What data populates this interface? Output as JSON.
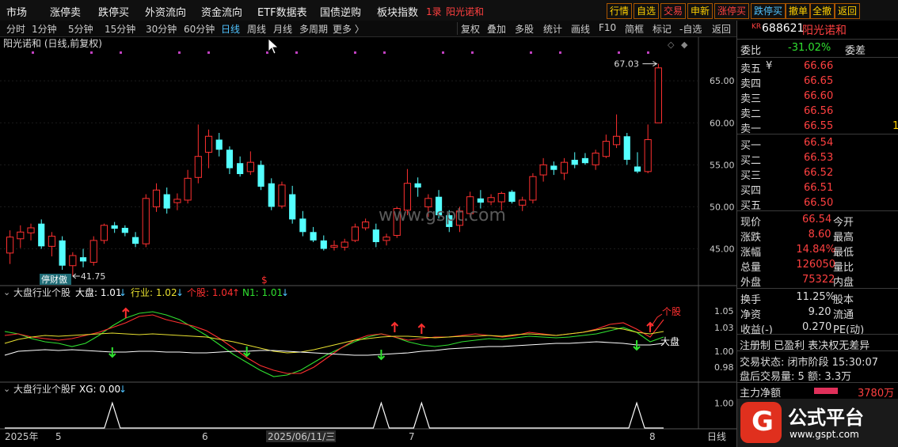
{
  "menu": {
    "left": [
      "市场",
      "涨停卖",
      "跌停买",
      "外资流向",
      "资金流向",
      "ETF数据表",
      "国债逆购",
      "板块指数"
    ],
    "tag": "1录",
    "stock_tag": "阳光诺和",
    "right": [
      "行情",
      "自选",
      "交易",
      "申新",
      "涨停买",
      "跌停买",
      "撤单",
      "全撤",
      "返回"
    ]
  },
  "periods": [
    "分时",
    "1分钟",
    "5分钟",
    "15分钟",
    "30分钟",
    "60分钟",
    "日线",
    "周线",
    "月线",
    "多周期",
    "更多 〉"
  ],
  "active_period": "日线",
  "tools": [
    "复权",
    "叠加",
    "多股",
    "统计",
    "画线",
    "F10",
    "简框",
    "标记",
    "-自选",
    "返回"
  ],
  "chart_title": "阳光诺和 (日线,前复权)",
  "chart_data": [
    {
      "type": "candlestick",
      "title": "阳光诺和 (日线,前复权)",
      "y_ticks": [
        45.0,
        50.0,
        55.0,
        60.0,
        65.0
      ],
      "ylim": [
        41.0,
        68.5
      ],
      "max_label": "67.03",
      "min_label": "41.75",
      "candles": [
        {
          "o": 44.5,
          "h": 47.2,
          "l": 43.2,
          "c": 46.4
        },
        {
          "o": 46.2,
          "h": 47.8,
          "l": 45.1,
          "c": 47.0
        },
        {
          "o": 46.9,
          "h": 48.0,
          "l": 46.0,
          "c": 47.5
        },
        {
          "o": 48.0,
          "h": 48.5,
          "l": 45.0,
          "c": 45.3
        },
        {
          "o": 45.3,
          "h": 47.0,
          "l": 44.1,
          "c": 46.5
        },
        {
          "o": 46.0,
          "h": 46.5,
          "l": 42.5,
          "c": 43.0
        },
        {
          "o": 43.0,
          "h": 44.6,
          "l": 41.75,
          "c": 44.2
        },
        {
          "o": 44.0,
          "h": 45.0,
          "l": 42.8,
          "c": 43.5
        },
        {
          "o": 43.4,
          "h": 46.5,
          "l": 43.0,
          "c": 46.0
        },
        {
          "o": 46.0,
          "h": 48.0,
          "l": 45.6,
          "c": 47.8
        },
        {
          "o": 47.8,
          "h": 48.2,
          "l": 46.9,
          "c": 47.4
        },
        {
          "o": 47.5,
          "h": 47.8,
          "l": 46.5,
          "c": 46.9
        },
        {
          "o": 46.4,
          "h": 47.0,
          "l": 45.2,
          "c": 45.6
        },
        {
          "o": 45.6,
          "h": 51.5,
          "l": 45.2,
          "c": 51.0
        },
        {
          "o": 50.0,
          "h": 52.8,
          "l": 49.4,
          "c": 52.0
        },
        {
          "o": 51.5,
          "h": 52.3,
          "l": 49.2,
          "c": 49.8
        },
        {
          "o": 50.5,
          "h": 51.6,
          "l": 49.6,
          "c": 50.9
        },
        {
          "o": 50.8,
          "h": 54.4,
          "l": 50.4,
          "c": 53.4
        },
        {
          "o": 53.5,
          "h": 59.8,
          "l": 52.8,
          "c": 56.0
        },
        {
          "o": 56.5,
          "h": 59.2,
          "l": 54.6,
          "c": 58.4
        },
        {
          "o": 58.0,
          "h": 58.8,
          "l": 56.0,
          "c": 56.8
        },
        {
          "o": 56.8,
          "h": 57.2,
          "l": 53.9,
          "c": 54.6
        },
        {
          "o": 55.2,
          "h": 56.0,
          "l": 53.6,
          "c": 53.9
        },
        {
          "o": 54.2,
          "h": 56.6,
          "l": 53.8,
          "c": 55.3
        },
        {
          "o": 55.0,
          "h": 55.5,
          "l": 52.0,
          "c": 52.4
        },
        {
          "o": 52.8,
          "h": 53.4,
          "l": 49.6,
          "c": 50.0
        },
        {
          "o": 50.1,
          "h": 53.0,
          "l": 49.8,
          "c": 52.6
        },
        {
          "o": 51.5,
          "h": 52.5,
          "l": 48.0,
          "c": 48.5
        },
        {
          "o": 48.6,
          "h": 49.5,
          "l": 46.5,
          "c": 47.0
        },
        {
          "o": 47.0,
          "h": 47.6,
          "l": 45.8,
          "c": 46.0
        },
        {
          "o": 46.0,
          "h": 46.6,
          "l": 44.8,
          "c": 45.0
        },
        {
          "o": 45.2,
          "h": 46.0,
          "l": 44.8,
          "c": 45.4
        },
        {
          "o": 45.2,
          "h": 46.2,
          "l": 44.8,
          "c": 45.8
        },
        {
          "o": 46.0,
          "h": 48.0,
          "l": 45.8,
          "c": 47.6
        },
        {
          "o": 47.5,
          "h": 48.6,
          "l": 47.2,
          "c": 48.2
        },
        {
          "o": 47.3,
          "h": 48.0,
          "l": 45.2,
          "c": 45.8
        },
        {
          "o": 46.0,
          "h": 46.8,
          "l": 45.4,
          "c": 46.4
        },
        {
          "o": 46.6,
          "h": 50.0,
          "l": 46.3,
          "c": 49.8
        },
        {
          "o": 49.6,
          "h": 54.5,
          "l": 49.0,
          "c": 52.8
        },
        {
          "o": 52.8,
          "h": 53.5,
          "l": 51.2,
          "c": 52.3
        },
        {
          "o": 50.0,
          "h": 51.5,
          "l": 48.8,
          "c": 51.0
        },
        {
          "o": 51.2,
          "h": 52.0,
          "l": 48.6,
          "c": 49.0
        },
        {
          "o": 49.0,
          "h": 49.6,
          "l": 47.0,
          "c": 47.6
        },
        {
          "o": 47.8,
          "h": 50.0,
          "l": 47.0,
          "c": 49.5
        },
        {
          "o": 49.2,
          "h": 51.8,
          "l": 48.8,
          "c": 51.2
        },
        {
          "o": 51.0,
          "h": 52.0,
          "l": 49.8,
          "c": 50.5
        },
        {
          "o": 50.6,
          "h": 51.5,
          "l": 50.2,
          "c": 51.1
        },
        {
          "o": 50.6,
          "h": 51.8,
          "l": 49.6,
          "c": 51.6
        },
        {
          "o": 51.8,
          "h": 52.0,
          "l": 50.4,
          "c": 50.6
        },
        {
          "o": 50.2,
          "h": 51.2,
          "l": 49.5,
          "c": 50.8
        },
        {
          "o": 50.8,
          "h": 54.0,
          "l": 50.4,
          "c": 53.6
        },
        {
          "o": 53.8,
          "h": 55.8,
          "l": 53.0,
          "c": 55.0
        },
        {
          "o": 54.9,
          "h": 55.4,
          "l": 53.8,
          "c": 54.4
        },
        {
          "o": 54.0,
          "h": 55.8,
          "l": 53.2,
          "c": 55.3
        },
        {
          "o": 55.6,
          "h": 56.5,
          "l": 54.6,
          "c": 55.0
        },
        {
          "o": 55.8,
          "h": 56.4,
          "l": 55.0,
          "c": 55.2
        },
        {
          "o": 55.0,
          "h": 56.8,
          "l": 54.4,
          "c": 56.4
        },
        {
          "o": 56.0,
          "h": 58.6,
          "l": 55.8,
          "c": 57.8
        },
        {
          "o": 57.4,
          "h": 61.0,
          "l": 57.0,
          "c": 58.4
        },
        {
          "o": 58.4,
          "h": 58.8,
          "l": 55.0,
          "c": 55.6
        },
        {
          "o": 54.8,
          "h": 56.5,
          "l": 54.0,
          "c": 54.2
        },
        {
          "o": 54.2,
          "h": 59.8,
          "l": 54.0,
          "c": 58.0
        },
        {
          "o": 60.0,
          "h": 67.03,
          "l": 60.0,
          "c": 66.54
        }
      ]
    },
    {
      "type": "line",
      "title": "大盘行业个股",
      "legend": [
        {
          "label": "大盘: 1.01",
          "color": "#ffffff"
        },
        {
          "label": "行业: 1.02",
          "color": "#e8e030"
        },
        {
          "label": "个股: 1.04",
          "color": "#ff3030"
        },
        {
          "label": "N1: 1.01",
          "color": "#30e030"
        }
      ],
      "y_ticks": [
        0.98,
        1.0,
        1.03,
        1.05
      ],
      "ylim": [
        0.965,
        1.065
      ],
      "series": [
        {
          "name": "大盘",
          "color": "#ffffff",
          "values": [
            0.995,
            1.0,
            1.001,
            1.002,
            1.001,
            1.002,
            1.001,
            1.0,
            0.999,
            0.999,
            1.0,
            1.0,
            0.999,
            0.999,
            0.998,
            0.998,
            0.999,
            1.0,
            1.0,
            1.001,
            1.001,
            1.0,
            0.999,
            0.998,
            0.997,
            0.996,
            0.995,
            0.995,
            0.996,
            0.997,
            0.998,
            1.0,
            1.001,
            1.003,
            1.004,
            1.005,
            1.006,
            1.006,
            1.007,
            1.008,
            1.009,
            1.01,
            1.01,
            1.011,
            1.012,
            1.011,
            1.01,
            1.008,
            1.008,
            1.01
          ]
        },
        {
          "name": "行业",
          "color": "#e8e030",
          "values": [
            1.01,
            1.015,
            1.018,
            1.02,
            1.019,
            1.02,
            1.021,
            1.022,
            1.023,
            1.022,
            1.021,
            1.022,
            1.021,
            1.02,
            1.019,
            1.018,
            1.015,
            1.012,
            1.008,
            1.004,
            1.0,
            0.998,
            0.999,
            1.002,
            1.006,
            1.01,
            1.014,
            1.016,
            1.018,
            1.019,
            1.019,
            1.018,
            1.017,
            1.018,
            1.019,
            1.019,
            1.02,
            1.019,
            1.021,
            1.022,
            1.021,
            1.02,
            1.022,
            1.024,
            1.027,
            1.03,
            1.028,
            1.024,
            1.022,
            1.025
          ]
        },
        {
          "name": "个股",
          "color": "#ff3030",
          "values": [
            1.02,
            1.022,
            1.018,
            1.016,
            1.014,
            1.016,
            1.02,
            1.024,
            1.03,
            1.036,
            1.044,
            1.046,
            1.04,
            1.036,
            1.032,
            1.026,
            1.016,
            1.004,
            0.992,
            0.982,
            0.976,
            0.972,
            0.972,
            0.98,
            0.992,
            1.004,
            1.014,
            1.02,
            1.022,
            1.018,
            1.014,
            1.016,
            1.018,
            1.018,
            1.02,
            1.022,
            1.02,
            1.018,
            1.02,
            1.024,
            1.022,
            1.02,
            1.022,
            1.024,
            1.028,
            1.034,
            1.036,
            1.028,
            1.018,
            1.04
          ]
        },
        {
          "name": "N1",
          "color": "#30e030",
          "values": [
            1.025,
            1.022,
            1.016,
            1.012,
            1.01,
            1.006,
            1.01,
            1.02,
            1.032,
            1.042,
            1.048,
            1.05,
            1.046,
            1.04,
            1.03,
            1.02,
            1.008,
            0.996,
            0.986,
            0.976,
            0.968,
            0.97,
            0.976,
            0.986,
            0.996,
            1.004,
            1.012,
            1.018,
            1.022,
            1.018,
            1.012,
            1.008,
            1.006,
            1.008,
            1.012,
            1.014,
            1.016,
            1.015,
            1.017,
            1.019,
            1.018,
            1.017,
            1.018,
            1.02,
            1.022,
            1.026,
            1.03,
            1.024,
            1.012,
            1.018
          ]
        }
      ],
      "up_arrow_idx": [
        9,
        29,
        31,
        48
      ],
      "down_arrow_idx": [
        8,
        18,
        28,
        47
      ],
      "label_gegu": "个股",
      "label_dapan": "大盘"
    },
    {
      "type": "line",
      "title": "大盘行业个股F",
      "legend": [
        {
          "label": "XG: 0.00",
          "color": "#ffffff"
        }
      ],
      "y_ticks": [
        1.0
      ],
      "ylim": [
        0,
        1.2
      ],
      "signal_idx": [
        8,
        28,
        31,
        47
      ]
    }
  ],
  "x_axis": [
    "2025年",
    "5",
    "6",
    "2025/06/11/三",
    "7",
    "8"
  ],
  "x_axis_right": "日线",
  "small_labels": {
    "marker_s": "$",
    "badge": "停财傲"
  },
  "watermark": "www.gspt.com",
  "quote": {
    "code_prefix": "KR",
    "code": "688621",
    "name": "阳光诺和",
    "weibi_label": "委比",
    "weibi_value": "-31.02%",
    "weicha_label": "委差",
    "sell": [
      {
        "label": "卖五",
        "value": "66.66"
      },
      {
        "label": "卖四",
        "value": "66.65"
      },
      {
        "label": "卖三",
        "value": "66.60"
      },
      {
        "label": "卖二",
        "value": "66.56"
      },
      {
        "label": "卖一",
        "value": "66.55",
        "vol": "16"
      }
    ],
    "buy": [
      {
        "label": "买一",
        "value": "66.54"
      },
      {
        "label": "买二",
        "value": "66.53"
      },
      {
        "label": "买三",
        "value": "66.52"
      },
      {
        "label": "买四",
        "value": "66.51"
      },
      {
        "label": "买五",
        "value": "66.50"
      }
    ],
    "yen": "¥",
    "stats": [
      {
        "l": "现价",
        "v": "66.54",
        "r": "今开"
      },
      {
        "l": "涨跌",
        "v": "8.60",
        "r": "最高"
      },
      {
        "l": "涨幅",
        "v": "14.84%",
        "r": "最低"
      },
      {
        "l": "总量",
        "v": "126050",
        "r": "量比"
      },
      {
        "l": "外盘",
        "v": "75322",
        "r": "内盘"
      }
    ],
    "stats2": [
      {
        "l": "换手",
        "v": "11.25%",
        "r": "股本"
      },
      {
        "l": "净资",
        "v": "9.20",
        "r": "流通"
      },
      {
        "l": "收益(-)",
        "v": "0.270",
        "r": "PE(动)"
      }
    ],
    "reg_tags": "注册制 已盈利 表决权无差异",
    "trade_status": "交易状态: 闭市阶段 15:30:07",
    "after_trade": "盘后交易量: 5  额: 3.3万",
    "main_flow_label": "主力净额",
    "main_flow_value": "3780万"
  },
  "brand": {
    "logo_letter": "G",
    "name": "公式平台",
    "url": "www.gspt.com"
  }
}
